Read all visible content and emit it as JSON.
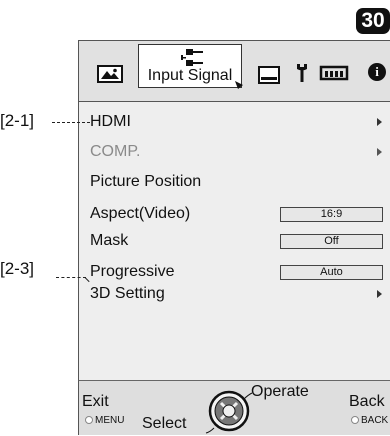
{
  "page": {
    "number": "30"
  },
  "tabs": {
    "active_label": "Input Signal",
    "icons": [
      "picture-adjust-icon",
      "input-signal-icon",
      "display-icon",
      "setup-wrench-icon",
      "network-icon",
      "info-icon"
    ],
    "info_glyph": "i"
  },
  "menu": {
    "items": [
      {
        "label": "HDMI",
        "has_submenu": true,
        "disabled": false
      },
      {
        "label": "COMP.",
        "has_submenu": true,
        "disabled": true
      },
      {
        "label": "Picture Position",
        "has_submenu": false,
        "disabled": false
      },
      {
        "label": "Aspect(Video)",
        "value": "16:9",
        "disabled": false
      },
      {
        "label": "Mask",
        "value": "Off",
        "disabled": false
      },
      {
        "label": "Progressive",
        "value": "Auto",
        "disabled": false
      },
      {
        "label": "3D Setting",
        "has_submenu": true,
        "disabled": false
      }
    ]
  },
  "callouts": {
    "hdmi": "[2-1]",
    "setting_3d": "[2-3]"
  },
  "footer": {
    "exit": "Exit",
    "menu_key": "MENU",
    "select": "Select",
    "operate": "Operate",
    "back": "Back",
    "back_key": "BACK"
  }
}
